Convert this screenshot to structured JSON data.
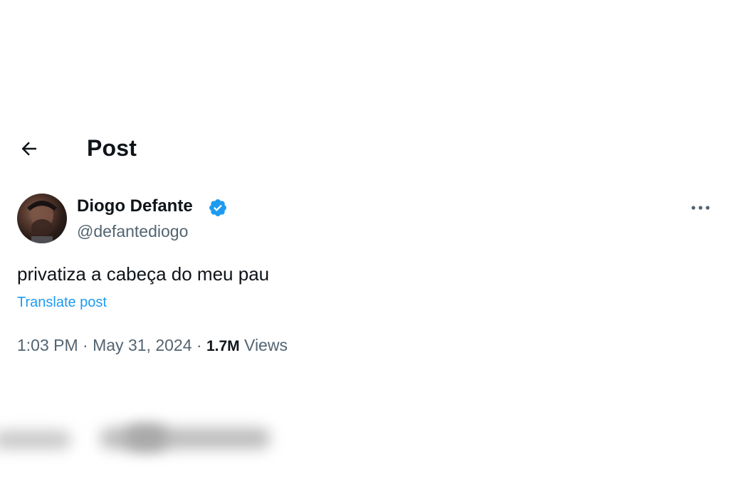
{
  "header": {
    "title": "Post"
  },
  "author": {
    "display_name": "Diogo Defante",
    "handle": "@defantediogo",
    "verified": true
  },
  "post": {
    "text": "privatiza a cabeça do meu pau",
    "translate_label": "Translate post",
    "time": "1:03 PM",
    "separator": "·",
    "date": "May 31, 2024",
    "views_count": "1.7M",
    "views_label": "Views"
  },
  "icons": {
    "back": "arrow-left-icon",
    "more": "more-horizontal-icon",
    "verified": "verified-badge-icon"
  },
  "colors": {
    "accent": "#1d9bf0",
    "text_primary": "#0f1419",
    "text_secondary": "#536471"
  }
}
